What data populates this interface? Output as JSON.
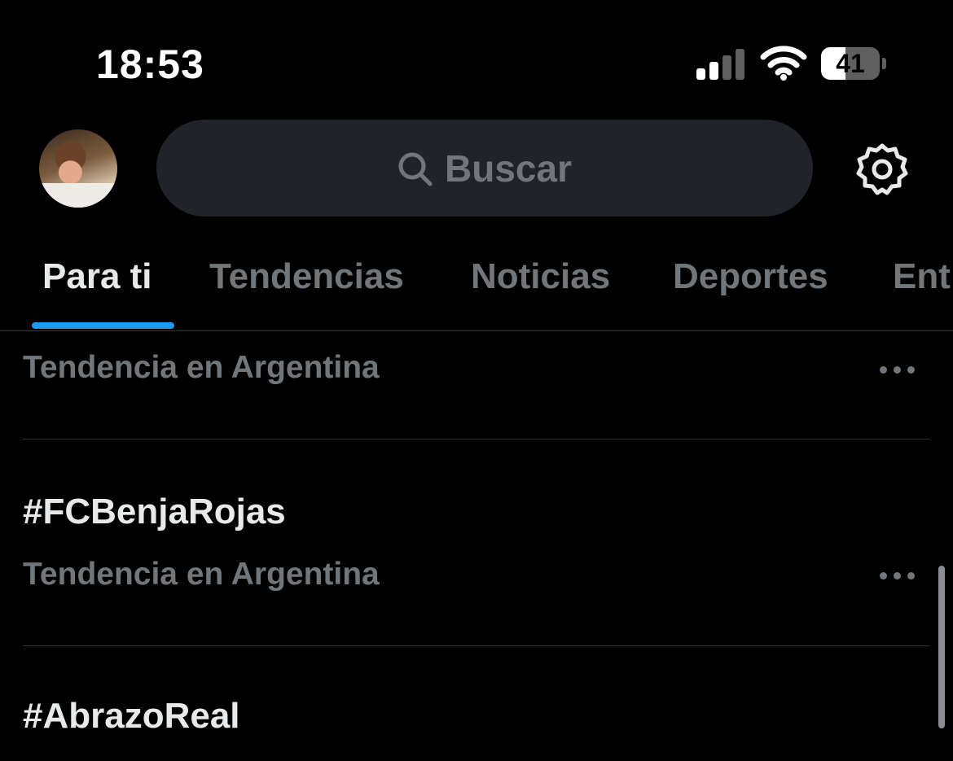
{
  "status_bar": {
    "time": "18:53",
    "battery_level": "41",
    "battery_fraction": 0.41,
    "signal_icon": "cellular-signal-icon",
    "wifi_icon": "wifi-icon",
    "battery_icon": "battery-icon"
  },
  "header": {
    "search_placeholder": "Buscar",
    "search_icon": "search-icon",
    "settings_icon": "gear-icon",
    "avatar_icon": "profile-avatar"
  },
  "tabs": [
    {
      "label": "Para ti",
      "active": true
    },
    {
      "label": "Tendencias",
      "active": false
    },
    {
      "label": "Noticias",
      "active": false
    },
    {
      "label": "Deportes",
      "active": false
    },
    {
      "label": "Ent",
      "active": false
    }
  ],
  "trends": [
    {
      "title": "",
      "meta": "Tendencia en Argentina"
    },
    {
      "title": "#FCBenjaRojas",
      "meta": "Tendencia en Argentina"
    },
    {
      "title": "#AbrazoReal",
      "meta": ""
    }
  ],
  "colors": {
    "background": "#000000",
    "accent": "#1d9bf0",
    "muted_text": "#71767b",
    "primary_text": "#e7e9ea",
    "search_bg": "#202327",
    "divider": "#2f3336"
  }
}
